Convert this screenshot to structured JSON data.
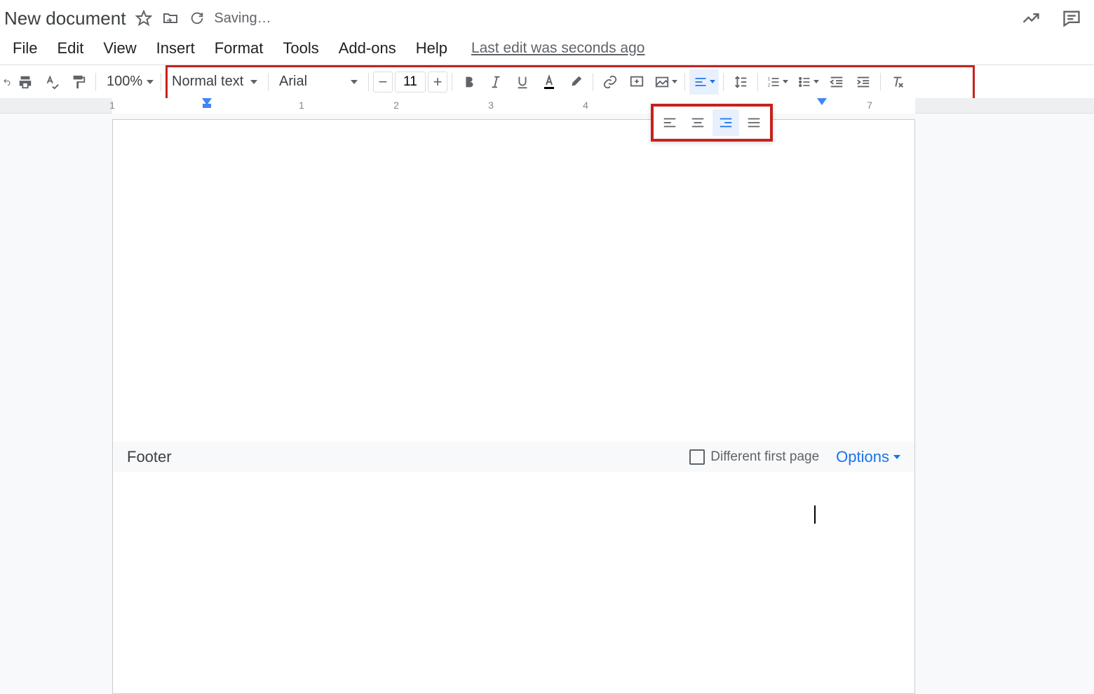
{
  "header": {
    "doc_title": "New document",
    "saving_text": "Saving…",
    "last_edit": "Last edit was seconds ago"
  },
  "menu": {
    "items": [
      "File",
      "Edit",
      "View",
      "Insert",
      "Format",
      "Tools",
      "Add-ons",
      "Help"
    ]
  },
  "toolbar": {
    "zoom": "100%",
    "style": "Normal text",
    "font": "Arial",
    "font_size": "11"
  },
  "ruler": {
    "numbers": [
      1,
      1,
      2,
      3,
      4,
      7
    ]
  },
  "footer": {
    "label": "Footer",
    "different_first_page": "Different first page",
    "options": "Options"
  }
}
